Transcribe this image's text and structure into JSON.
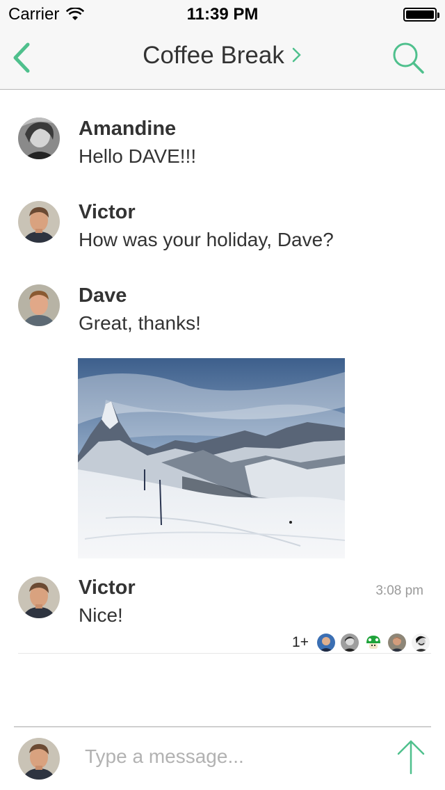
{
  "status_bar": {
    "carrier": "Carrier",
    "time": "11:39 PM",
    "wifi_icon": "wifi-icon",
    "battery_icon": "battery-full-icon",
    "battery_level": 1.0
  },
  "nav": {
    "title": "Coffee Break",
    "back_icon": "chevron-left-icon",
    "title_chevron_icon": "chevron-right-icon",
    "search_icon": "search-icon"
  },
  "colors": {
    "accent": "#4fc08d",
    "text": "#333333",
    "muted": "#9a9a9a",
    "placeholder": "#b2b2b2",
    "bar_background": "#f7f7f7"
  },
  "messages": [
    {
      "sender": "Amandine",
      "text": "Hello DAVE!!!",
      "timestamp": ""
    },
    {
      "sender": "Victor",
      "text": "How was your holiday, Dave?",
      "timestamp": ""
    },
    {
      "sender": "Dave",
      "text": "Great, thanks!",
      "timestamp": "",
      "attachment": "photo-snowy-mountain"
    },
    {
      "sender": "Victor",
      "text": "Nice!",
      "timestamp": "3:08 pm"
    }
  ],
  "read_receipts": {
    "count_label": "1+",
    "avatars": [
      "avatar-blue",
      "avatar-grey",
      "avatar-mushroom",
      "avatar-man",
      "avatar-bw"
    ]
  },
  "composer": {
    "placeholder": "Type a message...",
    "value": "",
    "send_icon": "arrow-up-icon"
  }
}
